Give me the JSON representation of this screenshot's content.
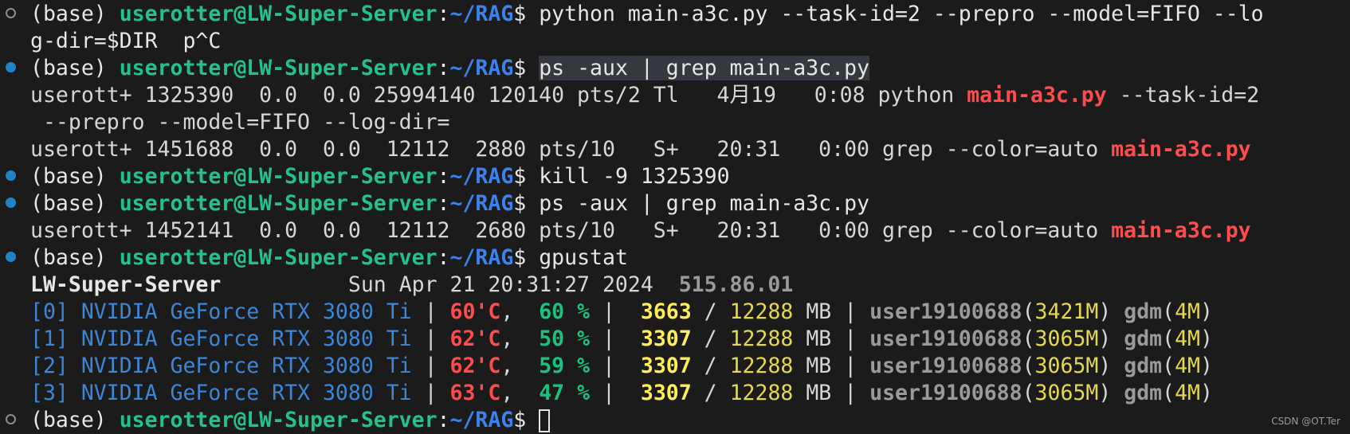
{
  "window": {
    "watermark": "CSDN @OT.Ter"
  },
  "prompt": {
    "env": "(base) ",
    "user_host": "userotter@LW-Super-Server",
    "colon": ":",
    "path": "~/RAG",
    "symbol": "$ "
  },
  "lines": {
    "l0_cmd": "python main-a3c.py --task-id=2 --prepro --model=FIFO --lo",
    "l1_text": "g-dir=$DIR  p^C",
    "l2_cmd": "ps -aux | grep main-a3c.py",
    "l3_a": "userott+ 1325390  0.0  0.0 25994140 120140 pts/2 Tl   4月19   0:08 python ",
    "l3_b": "main-a3c.py",
    "l3_c": " --task-id=2",
    "l4_text": " --prepro --model=FIFO --log-dir=",
    "l5_a": "userott+ 1451688  0.0  0.0  12112  2880 pts/10   S+   20:31   0:00 grep --color=auto ",
    "l5_b": "main-a3c.py",
    "l6_cmd": "kill -9 1325390",
    "l7_cmd": "ps -aux | grep main-a3c.py",
    "l8_a": "userott+ 1452141  0.0  0.0  12112  2680 pts/10   S+   20:31   0:00 grep --color=auto ",
    "l8_b": "main-a3c.py",
    "l9_cmd": "gpustat"
  },
  "gpustat": {
    "host": "LW-Super-Server",
    "pad": "          ",
    "date": "Sun Apr 21 20:31:27 2024",
    "gap": "  ",
    "driver": "515.86.01",
    "sep": " | ",
    "comma": ", ",
    "pct": " %",
    "slash": " / ",
    "mb": " MB",
    "rows": [
      {
        "id": "[0] NVIDIA GeForce RTX 3080 Ti",
        "temp": "60'C",
        "util": " 60",
        "mem_used": " 3663",
        "mem_total": "12288",
        "proc1": "user19100688",
        "proc1_mem": "3421M",
        "proc2": "gdm",
        "proc2_mem": "4M"
      },
      {
        "id": "[1] NVIDIA GeForce RTX 3080 Ti",
        "temp": "62'C",
        "util": " 50",
        "mem_used": " 3307",
        "mem_total": "12288",
        "proc1": "user19100688",
        "proc1_mem": "3065M",
        "proc2": "gdm",
        "proc2_mem": "4M"
      },
      {
        "id": "[2] NVIDIA GeForce RTX 3080 Ti",
        "temp": "62'C",
        "util": " 59",
        "mem_used": " 3307",
        "mem_total": "12288",
        "proc1": "user19100688",
        "proc1_mem": "3065M",
        "proc2": "gdm",
        "proc2_mem": "4M"
      },
      {
        "id": "[3] NVIDIA GeForce RTX 3080 Ti",
        "temp": "63'C",
        "util": " 47",
        "mem_used": " 3307",
        "mem_total": "12288",
        "proc1": "user19100688",
        "proc1_mem": "3065M",
        "proc2": "gdm",
        "proc2_mem": "4M"
      }
    ]
  },
  "colors": {
    "background": "#1b1b1b",
    "user_host": "#21c38c",
    "path": "#3b82f0",
    "match": "#ff4d4d",
    "marker": "#1f83c6"
  }
}
